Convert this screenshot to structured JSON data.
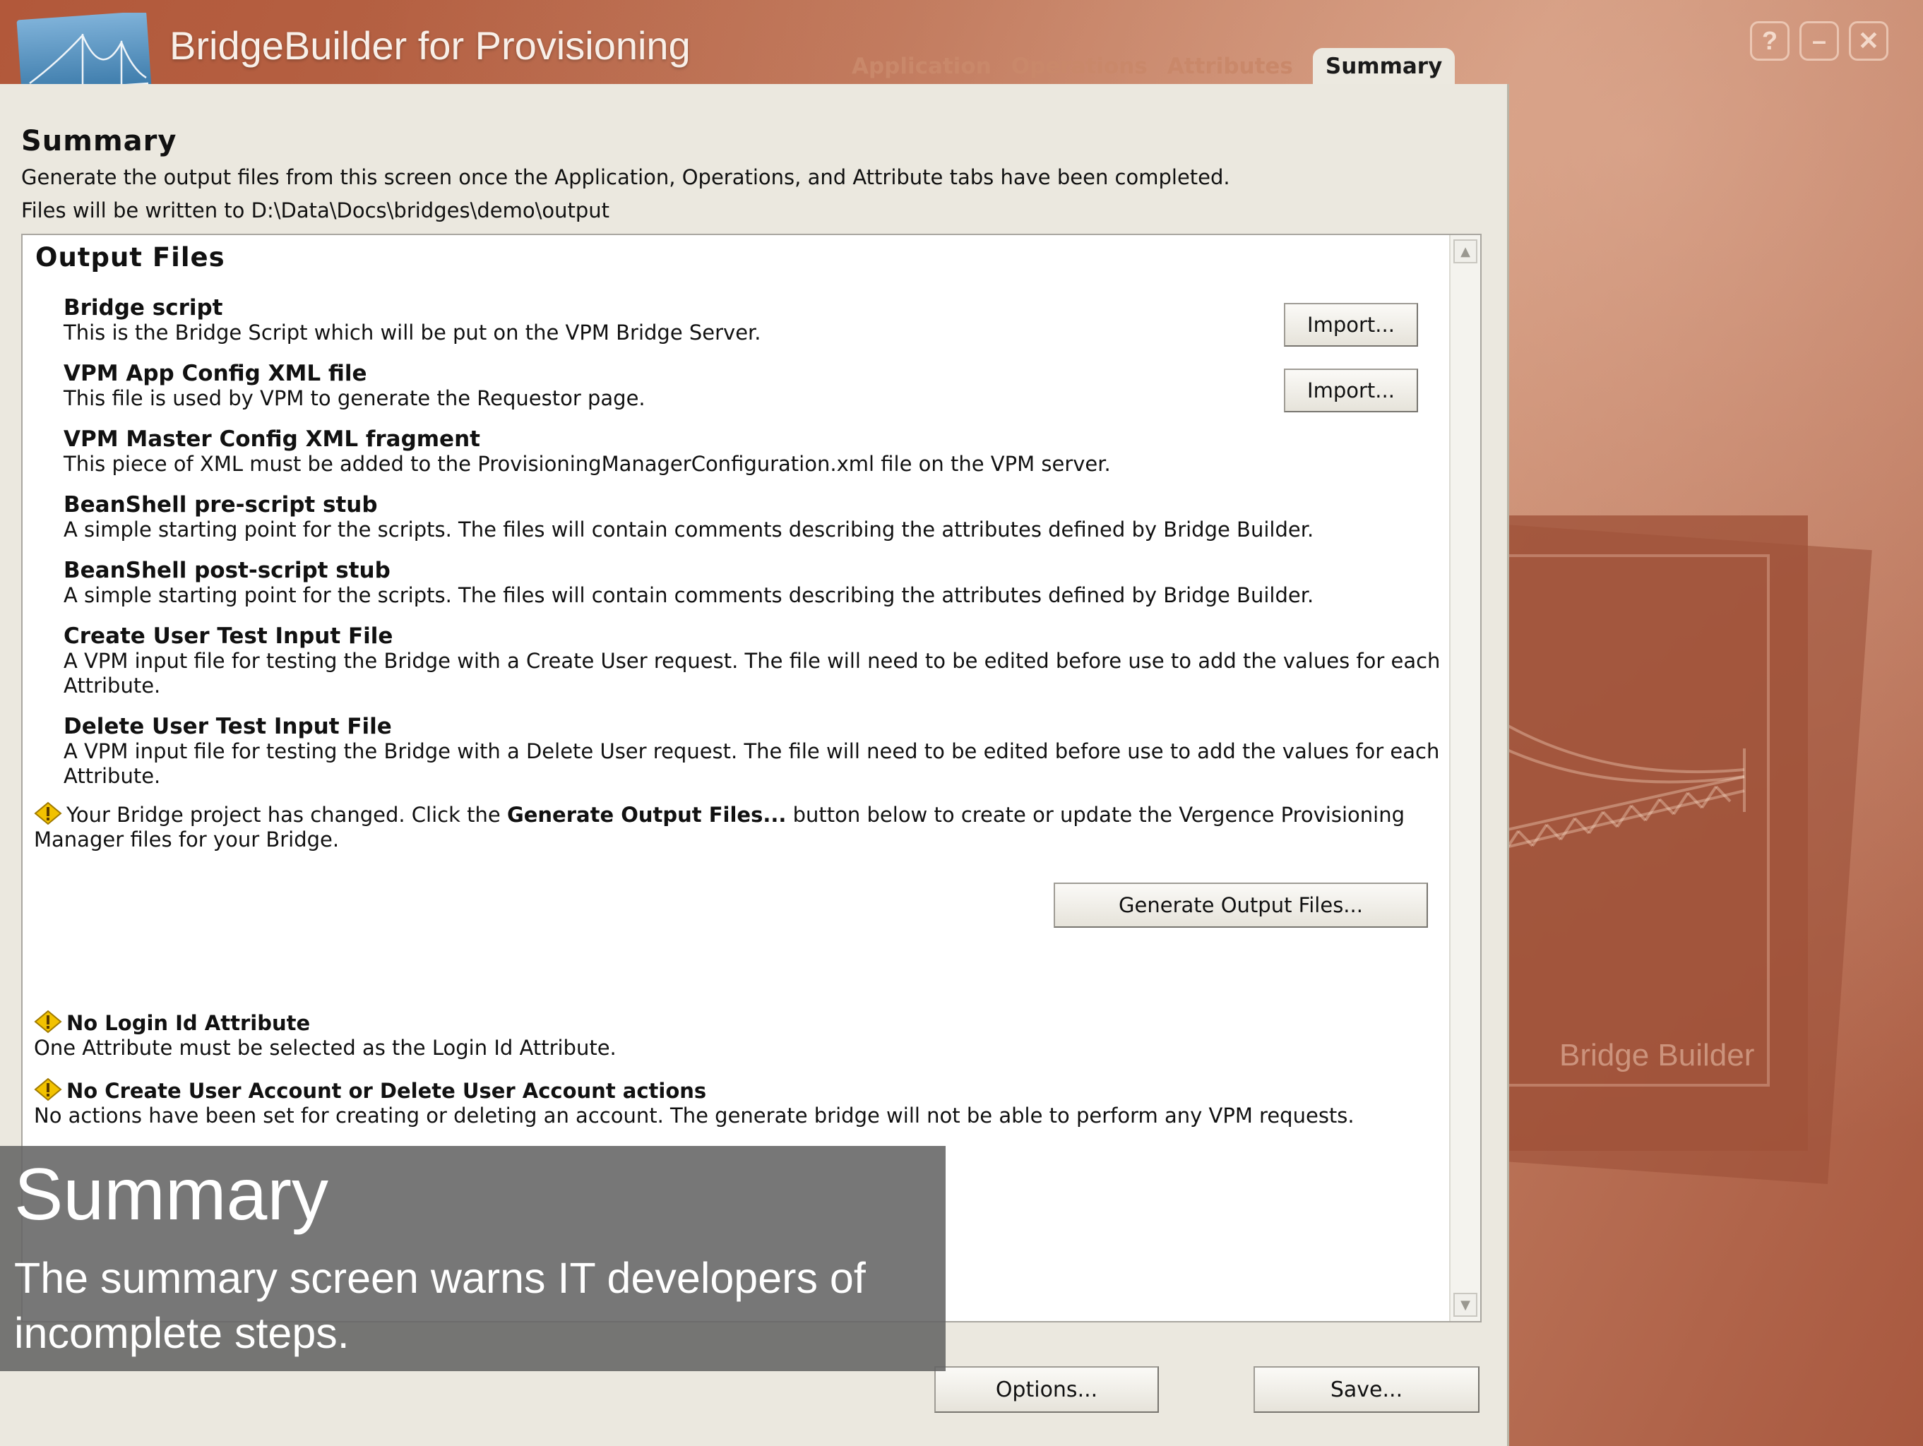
{
  "app": {
    "title": "BridgeBuilder for Provisioning",
    "logo_icon": "golden-gate-bridge-icon"
  },
  "window_controls": [
    {
      "name": "help-icon",
      "glyph": "?"
    },
    {
      "name": "minimize-icon",
      "glyph": "–"
    },
    {
      "name": "close-icon",
      "glyph": "✕"
    }
  ],
  "tabs": [
    {
      "label": "Application",
      "active": false
    },
    {
      "label": "Operations",
      "active": false
    },
    {
      "label": "Attributes",
      "active": false
    },
    {
      "label": "Summary",
      "active": true
    }
  ],
  "summary": {
    "heading": "Summary",
    "description": "Generate the output files from this screen once the Application, Operations, and Attribute tabs have been completed.",
    "output_path": "Files will be written to D:\\Data\\Docs\\bridges\\demo\\output"
  },
  "output_files": {
    "title": "Output Files",
    "items": [
      {
        "name": "Bridge script",
        "desc": "This is the Bridge Script which will be put on the VPM Bridge Server.",
        "button": "Import..."
      },
      {
        "name": "VPM App Config XML file",
        "desc": "This file is used by VPM to generate the Requestor page.",
        "button": "Import..."
      },
      {
        "name": "VPM Master Config XML fragment",
        "desc": "This piece of XML must be added to the ProvisioningManagerConfiguration.xml file on the VPM server."
      },
      {
        "name": "BeanShell pre-script stub",
        "desc": "A simple starting point for the scripts. The files will contain comments describing the attributes defined by Bridge Builder."
      },
      {
        "name": "BeanShell post-script stub",
        "desc": "A simple starting point for the scripts. The files will contain comments describing the attributes defined by Bridge Builder."
      },
      {
        "name": "Create User Test Input File",
        "desc": "A VPM input file for testing the Bridge with a Create User request. The file will need to be edited before use to add the values for each Attribute."
      },
      {
        "name": "Delete User Test Input File",
        "desc": "A VPM input file for testing the Bridge with a Delete User request. The file will need to be edited before use to add the values for each Attribute."
      }
    ],
    "changed_notice": {
      "prefix": "Your Bridge project has changed. Click the ",
      "bold": "Generate Output Files...",
      "suffix": " button below to create or update the Vergence Provisioning Manager files for your Bridge."
    },
    "generate_button": "Generate Output Files...",
    "warnings": [
      {
        "title": "No Login Id Attribute",
        "text": "One Attribute must be selected as the Login Id Attribute."
      },
      {
        "title": "No Create User Account or Delete User Account actions",
        "text": "No actions have been set for creating or deleting an account. The generate bridge will not be able to perform any VPM requests."
      }
    ]
  },
  "footer": {
    "options_button": "Options...",
    "save_button": "Save..."
  },
  "background": {
    "logo_text": "Bridge Builder"
  },
  "caption": {
    "title": "Summary",
    "text": "The summary screen warns IT developers of incomplete steps."
  },
  "colors": {
    "background_accent": "#b2583a",
    "panel": "#ebe8df",
    "warning_icon": "#f2c200"
  }
}
